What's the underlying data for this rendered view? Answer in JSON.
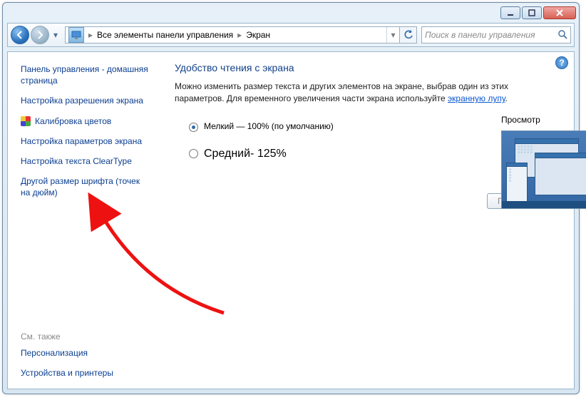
{
  "window_controls": {
    "min": "minimize",
    "max": "maximize",
    "close": "close"
  },
  "breadcrumb": {
    "root": "Все элементы панели управления",
    "leaf": "Экран"
  },
  "search": {
    "placeholder": "Поиск в панели управления"
  },
  "sidebar": {
    "items": [
      {
        "label": "Панель управления - домашняя страница"
      },
      {
        "label": "Настройка разрешения экрана"
      },
      {
        "label": "Калибровка цветов",
        "shield": true
      },
      {
        "label": "Настройка параметров экрана"
      },
      {
        "label": "Настройка текста ClearType"
      },
      {
        "label": "Другой размер шрифта (точек на дюйм)"
      }
    ],
    "see_also_title": "См. также",
    "see_also": [
      {
        "label": "Персонализация"
      },
      {
        "label": "Устройства и принтеры"
      }
    ]
  },
  "main": {
    "title": "Удобство чтения с экрана",
    "desc_a": "Можно изменить размер текста и других элементов на экране, выбрав один из этих параметров. Для временного увеличения части экрана используйте ",
    "desc_link": "экранную лупу",
    "desc_b": ".",
    "options": [
      {
        "label": "Мелкий — 100% (по умолчанию)",
        "checked": true
      },
      {
        "label": "Средний- 125%",
        "checked": false
      }
    ],
    "preview_label": "Просмотр",
    "apply": "Применить"
  }
}
